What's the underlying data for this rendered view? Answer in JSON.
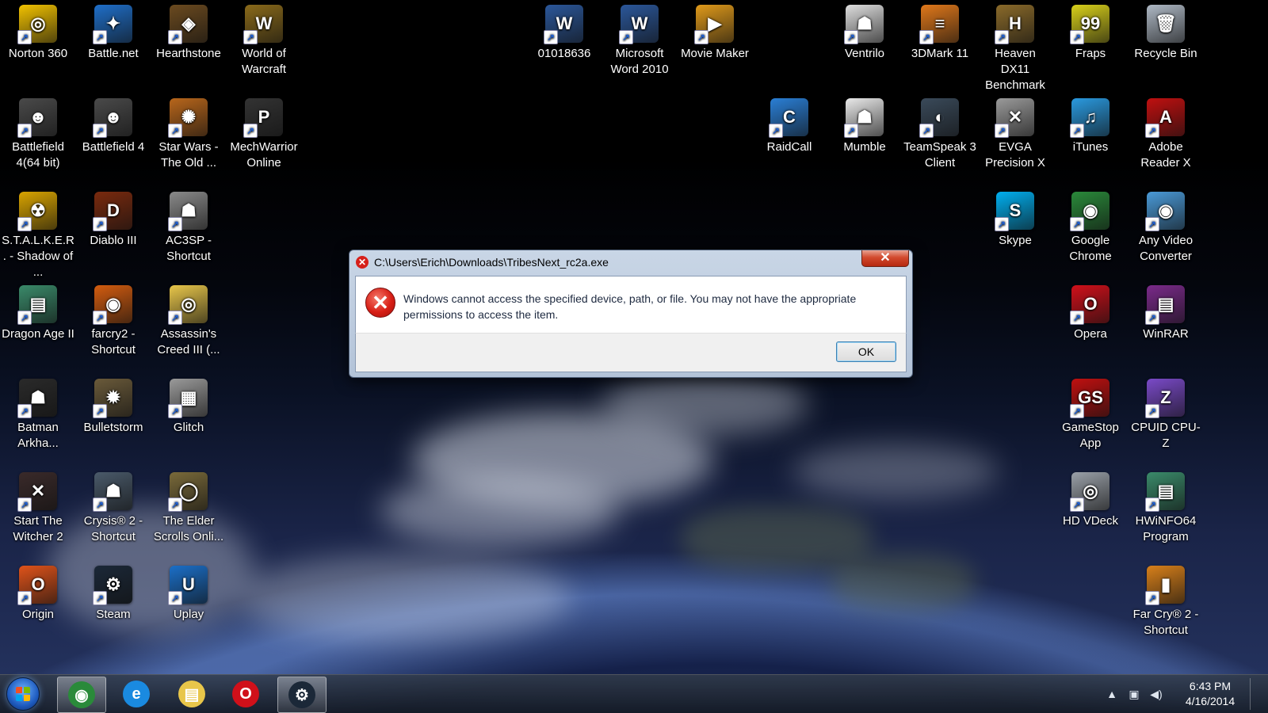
{
  "desktop": {
    "icons": [
      {
        "label": "Norton 360",
        "glyph": "◎",
        "color": "#f2c200"
      },
      {
        "label": "Battle.net",
        "glyph": "✦",
        "color": "#1f6fc9"
      },
      {
        "label": "Hearthstone",
        "glyph": "◈",
        "color": "#6b4a1f"
      },
      {
        "label": "World of Warcraft",
        "glyph": "W",
        "color": "#8a6a1a"
      },
      {
        "label": "Battlefield 4(64 bit)",
        "glyph": "☻",
        "color": "#4a4a4a"
      },
      {
        "label": "Battlefield 4",
        "glyph": "☻",
        "color": "#4a4a4a"
      },
      {
        "label": "Star Wars - The Old ...",
        "glyph": "✺",
        "color": "#b8661b"
      },
      {
        "label": "MechWarrior Online",
        "glyph": "P",
        "color": "#333333"
      },
      {
        "label": "S.T.A.L.K.E.R. - Shadow of ...",
        "glyph": "☢",
        "color": "#d9a400"
      },
      {
        "label": "Diablo III",
        "glyph": "D",
        "color": "#7a2a0e"
      },
      {
        "label": "AC3SP - Shortcut",
        "glyph": "☗",
        "color": "#8a8a8a"
      },
      {
        "label": "Dragon Age II",
        "glyph": "▤",
        "color": "#3a8a6a"
      },
      {
        "label": "farcry2 - Shortcut",
        "glyph": "◉",
        "color": "#d35c0f"
      },
      {
        "label": "Assassin's Creed III (...",
        "glyph": "◎",
        "color": "#e8c64a"
      },
      {
        "label": "Batman Arkha...",
        "glyph": "☗",
        "color": "#2a2a2a"
      },
      {
        "label": "Bulletstorm",
        "glyph": "✹",
        "color": "#6a5a3a"
      },
      {
        "label": "Glitch",
        "glyph": "▦",
        "color": "#9a9a9a"
      },
      {
        "label": "Start The Witcher 2",
        "glyph": "✕",
        "color": "#3a2a2a"
      },
      {
        "label": "Crysis® 2 - Shortcut",
        "glyph": "☗",
        "color": "#4a5a6a"
      },
      {
        "label": "The Elder Scrolls Onli...",
        "glyph": "◯",
        "color": "#7a6a3a"
      },
      {
        "label": "Origin",
        "glyph": "O",
        "color": "#e0531a"
      },
      {
        "label": "Steam",
        "glyph": "⚙",
        "color": "#1b2838"
      },
      {
        "label": "Uplay",
        "glyph": "U",
        "color": "#1b6fc8"
      },
      {
        "label": "01018636",
        "glyph": "W",
        "color": "#2b579a"
      },
      {
        "label": "Microsoft Word 2010",
        "glyph": "W",
        "color": "#2b579a"
      },
      {
        "label": "Movie Maker",
        "glyph": "▶",
        "color": "#e09a1a"
      },
      {
        "label": "Ventrilo",
        "glyph": "☗",
        "color": "#dedede"
      },
      {
        "label": "3DMark 11",
        "glyph": "≡",
        "color": "#e0781a"
      },
      {
        "label": "Heaven DX11 Benchmark ...",
        "glyph": "H",
        "color": "#8a6a2a"
      },
      {
        "label": "Fraps",
        "glyph": "99",
        "color": "#d8d01a"
      },
      {
        "label": "Recycle Bin",
        "glyph": "🗑",
        "color": "#aeb8c4"
      },
      {
        "label": "RaidCall",
        "glyph": "C",
        "color": "#2a7fd6"
      },
      {
        "label": "Mumble",
        "glyph": "☗",
        "color": "#eaeaea"
      },
      {
        "label": "TeamSpeak 3 Client",
        "glyph": "◐",
        "color": "#3a4a5a"
      },
      {
        "label": "EVGA Precision X",
        "glyph": "✕",
        "color": "#9a9a9a"
      },
      {
        "label": "iTunes",
        "glyph": "♫",
        "color": "#2a9ae0"
      },
      {
        "label": "Adobe Reader X",
        "glyph": "A",
        "color": "#c01010"
      },
      {
        "label": "Skype",
        "glyph": "S",
        "color": "#00aff0"
      },
      {
        "label": "Google Chrome",
        "glyph": "◉",
        "color": "#2a8a3a"
      },
      {
        "label": "Any Video Converter",
        "glyph": "◉",
        "color": "#4a9ad8"
      },
      {
        "label": "Opera",
        "glyph": "O",
        "color": "#d0101a"
      },
      {
        "label": "WinRAR",
        "glyph": "▤",
        "color": "#7a2a8a"
      },
      {
        "label": "GameStop App",
        "glyph": "GS",
        "color": "#c01010"
      },
      {
        "label": "CPUID CPU-Z",
        "glyph": "Z",
        "color": "#7a4ac8"
      },
      {
        "label": "HD VDeck",
        "glyph": "◎",
        "color": "#9aa0a8"
      },
      {
        "label": "HWiNFO64 Program",
        "glyph": "▤",
        "color": "#3a8a6a"
      },
      {
        "label": "Far Cry® 2 - Shortcut",
        "glyph": "▮",
        "color": "#d8801a"
      }
    ]
  },
  "dialog": {
    "title": "C:\\Users\\Erich\\Downloads\\TribesNext_rc2a.exe",
    "close_label": "✕",
    "message": "Windows cannot access the specified device, path, or file.  You may not have the appropriate permissions to access the item.",
    "ok_label": "OK",
    "error_glyph": "✕"
  },
  "taskbar": {
    "pinned": [
      {
        "name": "Google Chrome",
        "glyph": "◉",
        "color": "#2a8a3a",
        "active": true
      },
      {
        "name": "Internet Explorer",
        "glyph": "e",
        "color": "#1a8ae0",
        "active": false
      },
      {
        "name": "Windows Explorer",
        "glyph": "▤",
        "color": "#e8c64a",
        "active": false
      },
      {
        "name": "Opera",
        "glyph": "O",
        "color": "#d0101a",
        "active": false
      },
      {
        "name": "Steam",
        "glyph": "⚙",
        "color": "#1b2838",
        "active": true
      }
    ],
    "tray": {
      "show_hidden": "▲",
      "network_icon": "▣",
      "volume_icon": "◀)",
      "time": "6:43 PM",
      "date": "4/16/2014"
    }
  }
}
